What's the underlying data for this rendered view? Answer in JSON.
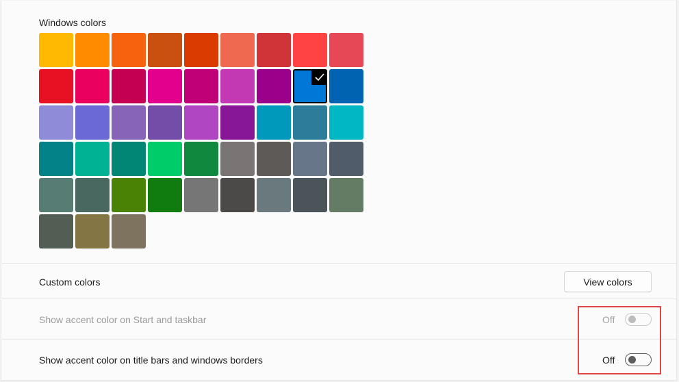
{
  "windows_colors": {
    "title": "Windows colors",
    "selected_index": 16,
    "swatches": [
      "#ffb900",
      "#ff8c00",
      "#f7630c",
      "#ca5010",
      "#da3b01",
      "#ef6950",
      "#d13438",
      "#ff4343",
      "#e74856",
      "#e81123",
      "#ea005e",
      "#c30052",
      "#e3008c",
      "#bf0077",
      "#c239b3",
      "#9a0089",
      "#0078d7",
      "#0063b1",
      "#8e8cd8",
      "#6b69d6",
      "#8764b8",
      "#744da9",
      "#b146c2",
      "#881798",
      "#0099bc",
      "#2d7d9a",
      "#00b7c3",
      "#038387",
      "#00b294",
      "#018574",
      "#00cc6a",
      "#10893e",
      "#7a7574",
      "#5d5a58",
      "#68768a",
      "#515c6b",
      "#567c73",
      "#486860",
      "#498205",
      "#107c10",
      "#767676",
      "#4c4a48",
      "#69797e",
      "#4a5459",
      "#647c64",
      "#525e54",
      "#847545",
      "#7e735f"
    ]
  },
  "custom_colors": {
    "label": "Custom colors",
    "button_label": "View colors"
  },
  "accent_start_taskbar": {
    "label": "Show accent color on Start and taskbar",
    "state": "Off"
  },
  "accent_title_bars": {
    "label": "Show accent color on title bars and windows borders",
    "state": "Off"
  }
}
